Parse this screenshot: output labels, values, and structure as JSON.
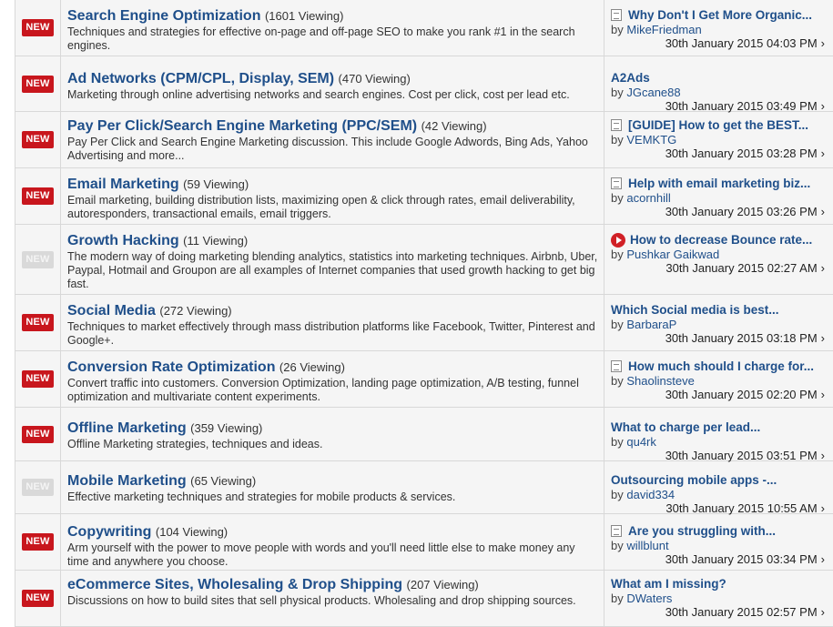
{
  "forums": [
    {
      "badge": "NEW",
      "badge_active": true,
      "title": "Search Engine Optimization",
      "viewing": "(1601 Viewing)",
      "description": "Techniques and strategies for effective on-page and off-page SEO to make you rank #1 in the search engines.",
      "last_thread": "Why Don't I Get More Organic...",
      "thread_icon": "doc-icon",
      "author": "MikeFriedman",
      "date": "30th January 2015 04:03 PM"
    },
    {
      "badge": "NEW",
      "badge_active": true,
      "title": "Ad Networks (CPM/CPL, Display, SEM)",
      "viewing": "(470 Viewing)",
      "description": "Marketing through online advertising networks and search engines. Cost per click, cost per lead etc.",
      "last_thread": "A2Ads",
      "thread_icon": "",
      "author": "JGcane88",
      "date": "30th January 2015 03:49 PM"
    },
    {
      "badge": "NEW",
      "badge_active": true,
      "title": "Pay Per Click/Search Engine Marketing (PPC/SEM)",
      "viewing": "(42 Viewing)",
      "description": "Pay Per Click and Search Engine Marketing discussion. This include Google Adwords, Bing Ads, Yahoo Advertising and more...",
      "last_thread": "[GUIDE] How to get the BEST...",
      "thread_icon": "doc-icon",
      "author": "VEMKTG",
      "date": "30th January 2015 03:28 PM"
    },
    {
      "badge": "NEW",
      "badge_active": true,
      "title": "Email Marketing",
      "viewing": "(59 Viewing)",
      "description": "Email marketing, building distribution lists, maximizing open & click through rates, email deliverability, autoresponders, transactional emails, email triggers.",
      "last_thread": "Help with email marketing biz...",
      "thread_icon": "doc-icon",
      "author": "acornhill",
      "date": "30th January 2015 03:26 PM"
    },
    {
      "badge": "NEW",
      "badge_active": false,
      "title": "Growth Hacking",
      "viewing": "(11 Viewing)",
      "description": "The modern way of doing marketing blending analytics, statistics into marketing techniques. Airbnb, Uber, Paypal, Hotmail and Groupon are all examples of Internet companies that used growth hacking to get big fast.",
      "last_thread": "How to decrease Bounce rate...",
      "thread_icon": "play-icon",
      "author": "Pushkar Gaikwad",
      "date": "30th January 2015 02:27 AM"
    },
    {
      "badge": "NEW",
      "badge_active": true,
      "title": "Social Media",
      "viewing": "(272 Viewing)",
      "description": "Techniques to market effectively through mass distribution platforms like Facebook, Twitter, Pinterest and Google+.",
      "last_thread": "Which Social media is best...",
      "thread_icon": "",
      "author": "BarbaraP",
      "date": "30th January 2015 03:18 PM"
    },
    {
      "badge": "NEW",
      "badge_active": true,
      "title": "Conversion Rate Optimization",
      "viewing": "(26 Viewing)",
      "description": "Convert traffic into customers. Conversion Optimization, landing page optimization, A/B testing, funnel optimization and multivariate content experiments.",
      "last_thread": "How much should I charge for...",
      "thread_icon": "doc-icon",
      "author": "Shaolinsteve",
      "date": "30th January 2015 02:20 PM"
    },
    {
      "badge": "NEW",
      "badge_active": true,
      "title": "Offline Marketing",
      "viewing": "(359 Viewing)",
      "description": "Offline Marketing strategies, techniques and ideas.",
      "last_thread": "What to charge per lead...",
      "thread_icon": "",
      "author": "qu4rk",
      "date": "30th January 2015 03:51 PM"
    },
    {
      "badge": "NEW",
      "badge_active": false,
      "title": "Mobile Marketing",
      "viewing": "(65 Viewing)",
      "description": "Effective marketing techniques and strategies for mobile products & services.",
      "last_thread": "Outsourcing mobile apps -...",
      "thread_icon": "",
      "author": "david334",
      "date": "30th January 2015 10:55 AM"
    },
    {
      "badge": "NEW",
      "badge_active": true,
      "title": "Copywriting",
      "viewing": "(104 Viewing)",
      "description": "Arm yourself with the power to move people with words and you'll need little else to make money any time and anywhere you choose.",
      "last_thread": "Are you struggling with...",
      "thread_icon": "doc-icon",
      "author": "willblunt",
      "date": "30th January 2015 03:34 PM"
    },
    {
      "badge": "NEW",
      "badge_active": true,
      "title": "eCommerce Sites, Wholesaling & Drop Shipping",
      "viewing": "(207 Viewing)",
      "description": "Discussions on how to build sites that sell physical products. Wholesaling and drop shipping sources.",
      "last_thread": "What am I missing?",
      "thread_icon": "",
      "author": "DWaters",
      "date": "30th January 2015 02:57 PM"
    }
  ],
  "labels": {
    "by": "by",
    "chevron": "›"
  },
  "colors": {
    "badge_new": "#c8161d",
    "badge_read": "#d9d9d9",
    "link": "#1f4f8a"
  }
}
